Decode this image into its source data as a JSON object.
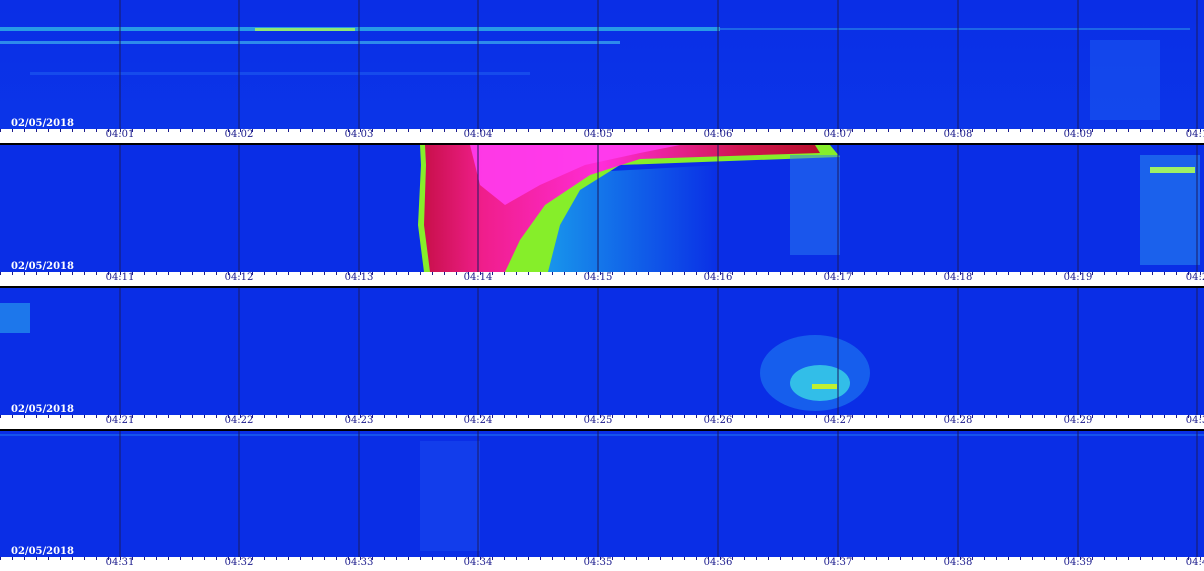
{
  "date_label": "02/05/2018",
  "strips": [
    {
      "date": "02/05/2018",
      "ticks": [
        "04:01",
        "04:02",
        "04:03",
        "04:04",
        "04:05",
        "04:06",
        "04:07",
        "04:08",
        "04:09",
        "04:1"
      ]
    },
    {
      "date": "02/05/2018",
      "ticks": [
        "04:11",
        "04:12",
        "04:13",
        "04:14",
        "04:15",
        "04:16",
        "04:17",
        "04:18",
        "04:19",
        "04:2"
      ]
    },
    {
      "date": "02/05/2018",
      "ticks": [
        "04:21",
        "04:22",
        "04:23",
        "04:24",
        "04:25",
        "04:26",
        "04:27",
        "04:28",
        "04:29",
        "04:3"
      ]
    },
    {
      "date": "02/05/2018",
      "ticks": [
        "04:31",
        "04:32",
        "04:33",
        "04:34",
        "04:35",
        "04:36",
        "04:37",
        "04:38",
        "04:39",
        "04:4"
      ]
    }
  ],
  "colors": {
    "background": "#0a2ee6",
    "gridline": "#1a1a60",
    "axis_text": "#1a1a8c",
    "date_text": "#ffffff"
  }
}
